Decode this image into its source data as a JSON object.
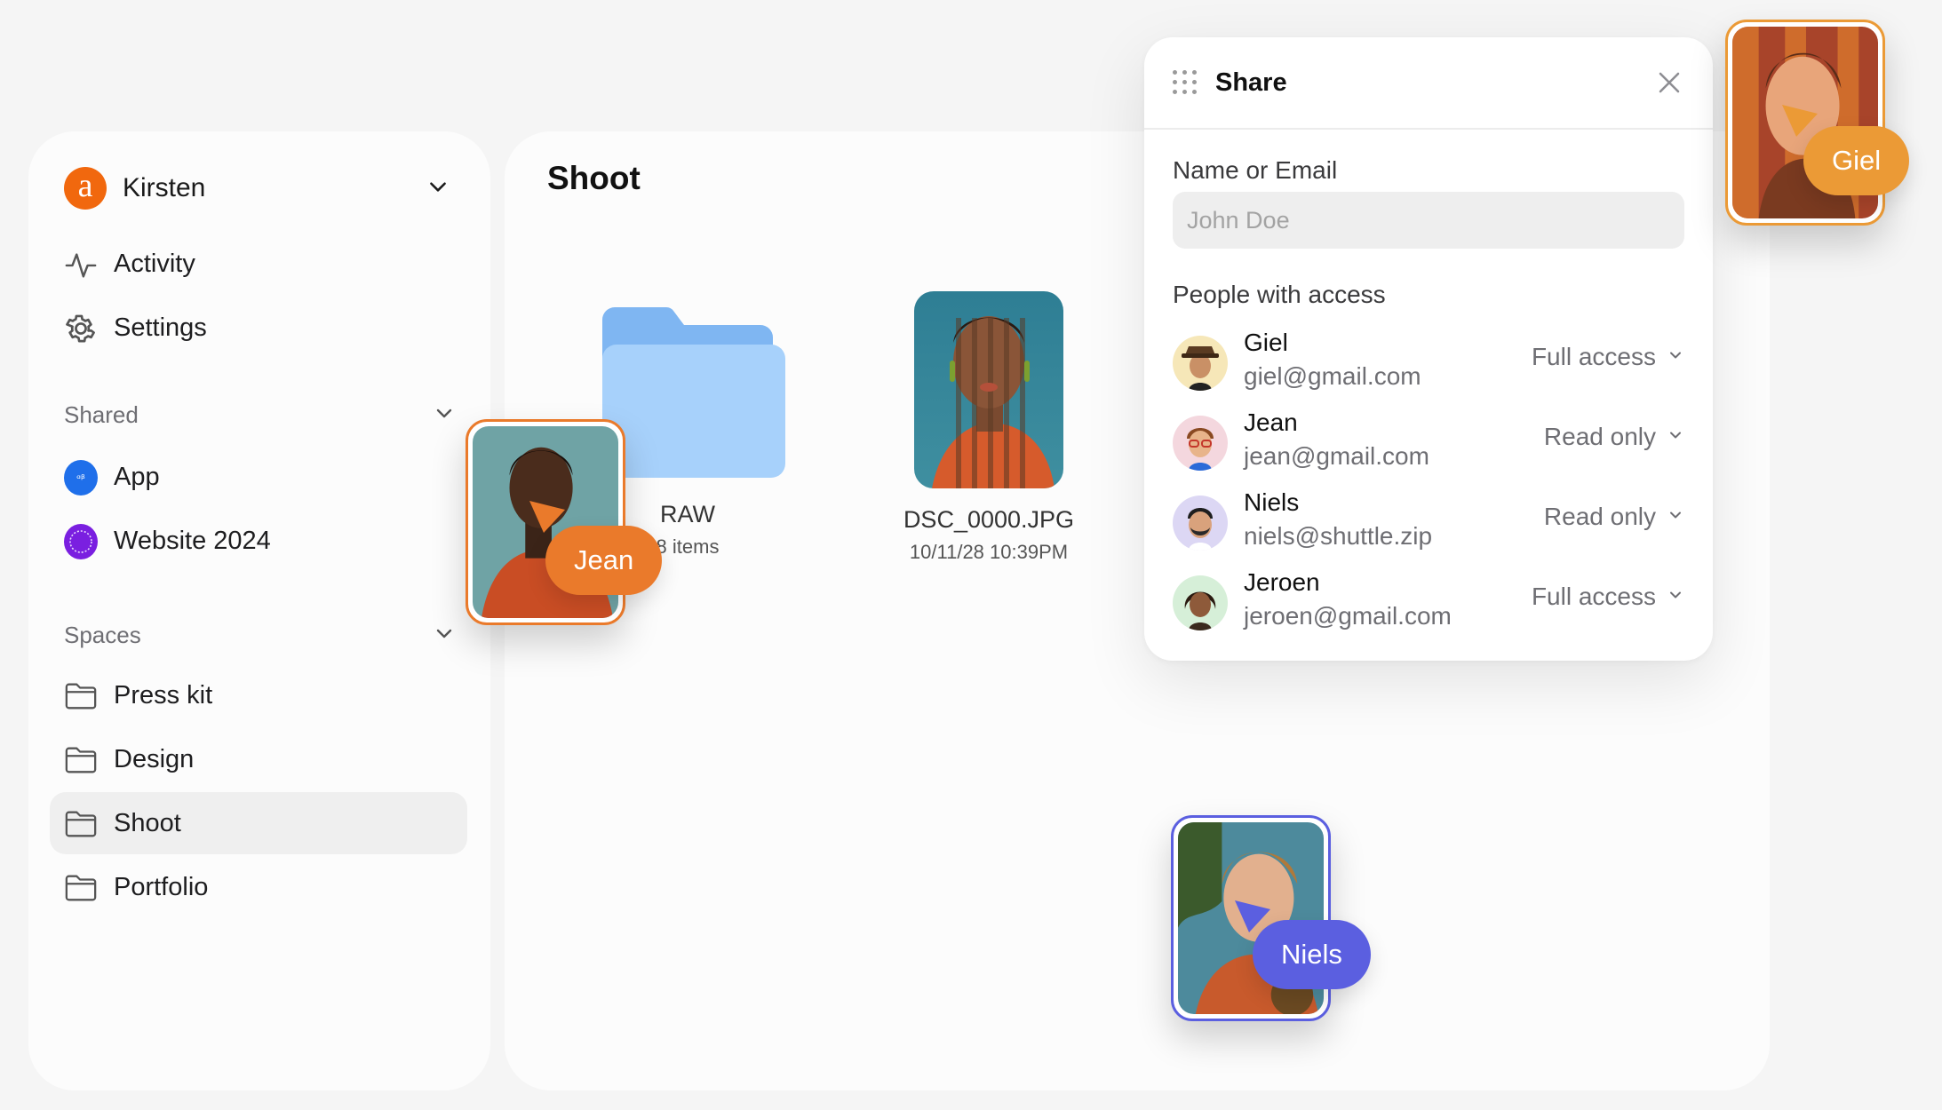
{
  "sidebar": {
    "account": {
      "name": "Kirsten",
      "logo_letter": "a"
    },
    "nav": [
      {
        "label": "Activity",
        "icon": "activity-icon"
      },
      {
        "label": "Settings",
        "icon": "gear-icon"
      }
    ],
    "shared": {
      "heading": "Shared",
      "items": [
        {
          "label": "App",
          "icon": "app-icon"
        },
        {
          "label": "Website 2024",
          "icon": "website-icon"
        }
      ]
    },
    "spaces": {
      "heading": "Spaces",
      "items": [
        {
          "label": "Press kit",
          "icon": "folder-icon"
        },
        {
          "label": "Design",
          "icon": "folder-icon"
        },
        {
          "label": "Shoot",
          "icon": "folder-icon",
          "active": true
        },
        {
          "label": "Portfolio",
          "icon": "folder-icon"
        }
      ]
    }
  },
  "main": {
    "title": "Shoot",
    "files": [
      {
        "name": "RAW",
        "meta": "8 items",
        "type": "folder"
      },
      {
        "name": "DSC_0000.JPG",
        "meta": "10/11/28 10:39PM",
        "type": "image"
      }
    ]
  },
  "cursors": [
    {
      "name": "Jean",
      "color": "#ea7a2b"
    },
    {
      "name": "Niels",
      "color": "#5b5fe0"
    },
    {
      "name": "Giel",
      "color": "#eb9a36"
    }
  ],
  "share": {
    "title": "Share",
    "field_label": "Name or Email",
    "placeholder": "John Doe",
    "people_label": "People with access",
    "people": [
      {
        "name": "Giel",
        "email": "giel@gmail.com",
        "access": "Full access",
        "avatar_bg": "#f6e7b8"
      },
      {
        "name": "Jean",
        "email": "jean@gmail.com",
        "access": "Read only",
        "avatar_bg": "#f4d7de"
      },
      {
        "name": "Niels",
        "email": "niels@shuttle.zip",
        "access": "Read only",
        "avatar_bg": "#dcd7f4"
      },
      {
        "name": "Jeroen",
        "email": "jeroen@gmail.com",
        "access": "Full access",
        "avatar_bg": "#d6efd8"
      }
    ]
  }
}
